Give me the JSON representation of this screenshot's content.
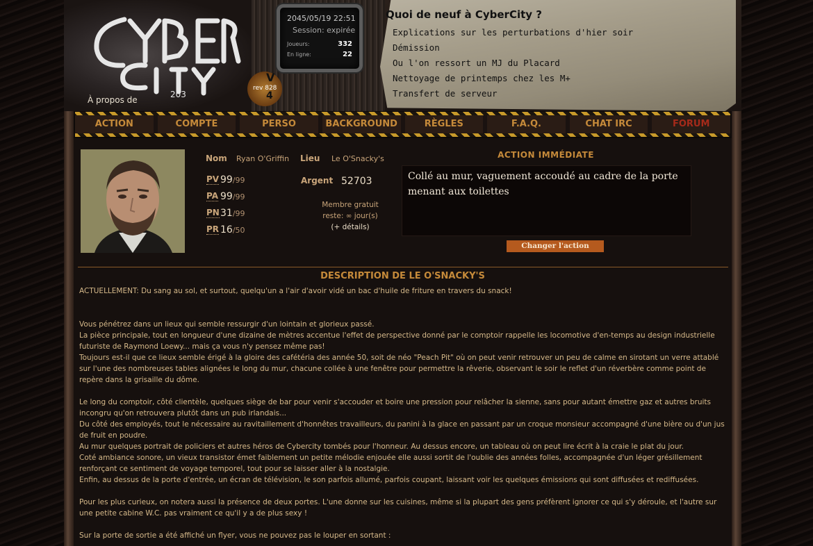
{
  "header": {
    "about": "À propos de",
    "monitor": {
      "datetime": "2045/05/19 22:51",
      "session": "Session: expirée",
      "players_label": "Joueurs:",
      "players": "332",
      "online_label": "En ligne:",
      "online": "22"
    },
    "rev": "rev 828",
    "rev_badge_top": "V",
    "rev_badge_bottom": "4",
    "news": {
      "title": "Quoi de neuf à CyberCity ?",
      "items": [
        "Explications sur les perturbations d'hier soir",
        "Démission",
        "Ou l'on ressort un MJ du Placard",
        "Nettoyage de printemps chez les M+",
        "Transfert de serveur"
      ]
    }
  },
  "nav": [
    "ACTION",
    "COMPTE",
    "PERSO",
    "BACKGROUND",
    "RÈGLES",
    "F.A.Q.",
    "CHAT IRC",
    "FORUM"
  ],
  "character": {
    "nom_label": "Nom",
    "nom": "Ryan O'Griffin",
    "lieu_label": "Lieu",
    "lieu": "Le O'Snacky's",
    "argent_label": "Argent",
    "argent": "52703",
    "stats": [
      {
        "label": "PV",
        "value": "99",
        "max": "/99"
      },
      {
        "label": "PA",
        "value": "99",
        "max": "/99"
      },
      {
        "label": "PN",
        "value": "31",
        "max": "/99"
      },
      {
        "label": "PR",
        "value": "16",
        "max": "/50"
      }
    ],
    "membre_line1": "Membre gratuit",
    "membre_line2": "reste: ∞ jour(s)",
    "details": "(+ détails)"
  },
  "action": {
    "title": "ACTION IMMÉDIATE",
    "text": "Collé au mur, vaguement accoudé au cadre de la porte menant aux toilettes",
    "button": "Changer l'action"
  },
  "description": {
    "title": "DESCRIPTION DE LE O'SNACKY'S",
    "paragraphs": [
      "ACTUELLEMENT: Du sang au sol, et surtout, quelqu'un a l'air d'avoir vidé un bac d'huile de friture en travers du snack!",
      "",
      "",
      "Vous pénétrez dans un lieux qui semble ressurgir d'un lointain et glorieux passé.",
      "La pièce principale, tout en longueur d'une dizaine de mètres accentue l'effet de perspective donné par le comptoir rappelle les locomotive d'en-temps au design industrielle futuriste de Raymond Loewy... mais ça vous n'y pensez même pas!",
      "Toujours est-il que ce lieux semble érigé à la gloire des cafétéria des année 50, soit de néo \"Peach Pit\" où on peut venir retrouver un peu de calme en sirotant un verre attablé sur l'une des nombreuses tables alignées le long du mur, chacune collée à une fenêtre pour permettre la rêverie, observant le soir le reflet d'un réverbère comme point de repère dans la grisaille du dôme.",
      "",
      "Le long du comptoir, côté clientèle, quelques siège de bar pour venir s'accouder et boire une pression pour relâcher la sienne, sans pour autant émettre gaz et autres bruits incongru qu'on retrouvera plutôt dans un pub irlandais...",
      "Du côté des employés, tout le nécessaire au ravitaillement d'honnêtes travailleurs, du panini à la glace en passant par un croque monsieur accompagné d'une bière ou d'un jus de fruit en poudre.",
      "Au mur quelques portrait de policiers et autres héros de Cybercity tombés pour l'honneur. Au dessus encore, un tableau où on peut lire écrit à la craie le plat du jour.",
      "Coté ambiance sonore, un vieux transistor émet faiblement un petite mélodie enjouée elle aussi sortit de l'oublie des années folles, accompagnée d'un léger grésillement renforçant ce sentiment de voyage temporel, tout pour se laisser aller à la nostalgie.",
      "Enfin, au dessus de la porte d'entrée, un écran de télévision, le son parfois allumé, parfois coupant, laissant voir les quelques émissions qui sont diffusées et rediffusées.",
      "",
      "Pour les plus curieux, on notera aussi la présence de deux portes. L'une donne sur les cuisines, même si la plupart des gens préfèrent ignorer ce qui s'y déroule, et l'autre sur une petite cabine W.C. pas vraiment ce qu'il y a de plus sexy !",
      "",
      "Sur la porte de sortie a été affiché un flyer, vous ne pouvez pas le louper en sortant :"
    ]
  }
}
